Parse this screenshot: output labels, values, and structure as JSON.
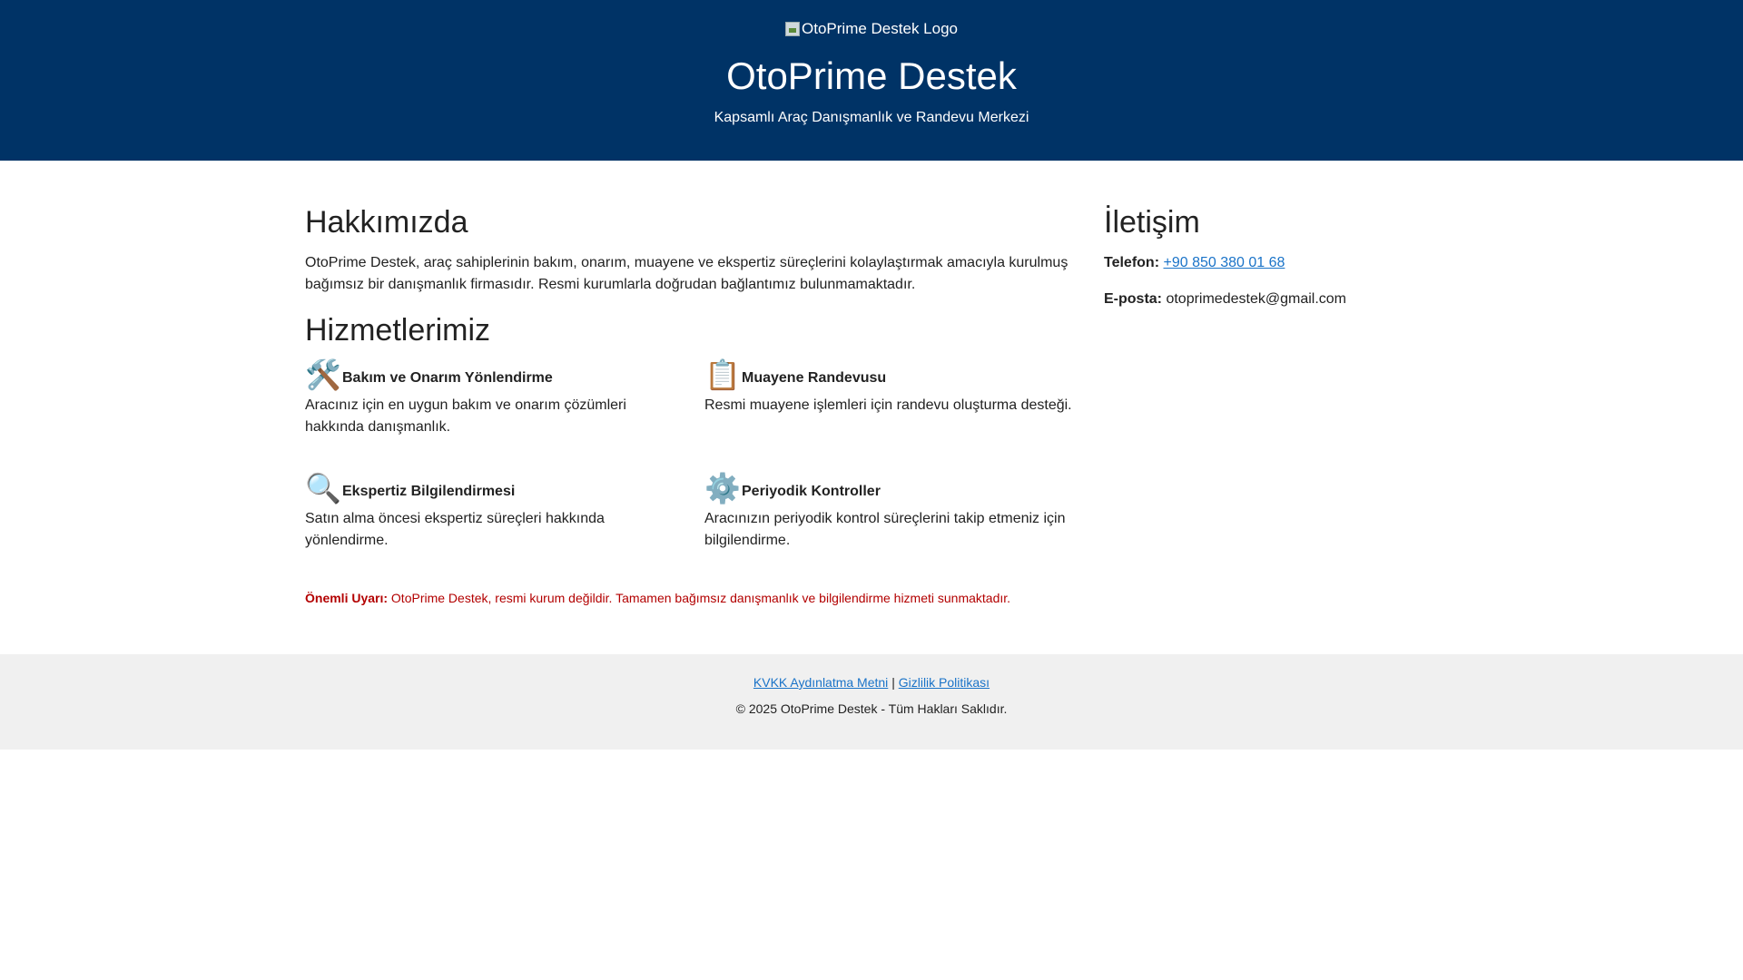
{
  "header": {
    "logo_alt": "OtoPrime Destek Logo",
    "title": "OtoPrime Destek",
    "subtitle": "Kapsamlı Araç Danışmanlık ve Randevu Merkezi"
  },
  "about": {
    "heading": "Hakkımızda",
    "text": "OtoPrime Destek, araç sahiplerinin bakım, onarım, muayene ve ekspertiz süreçlerini kolaylaştırmak amacıyla kurulmuş bağımsız bir danışmanlık firmasıdır. Resmi kurumlarla doğrudan bağlantımız bulunmamaktadır."
  },
  "services": {
    "heading": "Hizmetlerimiz",
    "items": [
      {
        "icon": "🛠️",
        "icon_name": "tools-icon",
        "title": "Bakım ve Onarım Yönlendirme",
        "desc": "Aracınız için en uygun bakım ve onarım çözümleri hakkında danışmanlık."
      },
      {
        "icon": "📋",
        "icon_name": "clipboard-icon",
        "title": "Muayene Randevusu",
        "desc": "Resmi muayene işlemleri için randevu oluşturma desteği."
      },
      {
        "icon": "🔍",
        "icon_name": "magnifier-icon",
        "title": "Ekspertiz Bilgilendirmesi",
        "desc": "Satın alma öncesi ekspertiz süreçleri hakkında yönlendirme."
      },
      {
        "icon": "⚙️",
        "icon_name": "gear-icon",
        "title": "Periyodik Kontroller",
        "desc": "Aracınızın periyodik kontrol süreçlerini takip etmeniz için bilgilendirme."
      }
    ]
  },
  "contact": {
    "heading": "İletişim",
    "phone_label": "Telefon:",
    "phone": "+90 850 380 01 68",
    "email_label": "E-posta:",
    "email": "otoprimedestek@gmail.com"
  },
  "warning": {
    "label": "Önemli Uyarı:",
    "text": "OtoPrime Destek, resmi kurum değildir. Tamamen bağımsız danışmanlık ve bilgilendirme hizmeti sunmaktadır."
  },
  "footer": {
    "kvkk": "KVKK Aydınlatma Metni",
    "separator": "|",
    "privacy": "Gizlilik Politikası",
    "copyright": "© 2025 OtoPrime Destek - Tüm Hakları Saklıdır."
  },
  "colors": {
    "header_bg": "#003366",
    "link": "#1a73c8",
    "warning": "#b30000",
    "footer_bg": "#f0f0f0"
  }
}
